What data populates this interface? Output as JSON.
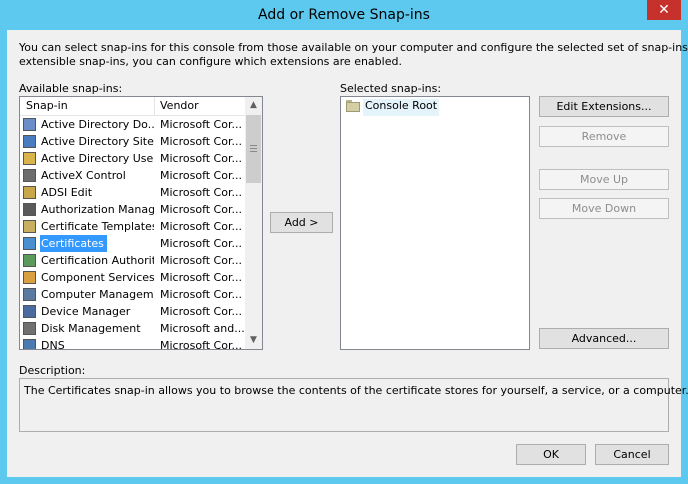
{
  "window": {
    "title": "Add or Remove Snap-ins",
    "close_glyph": "✕"
  },
  "intro_text_1": "You can select snap-ins for this console from those available on your computer and configure the selected set of snap-ins. For",
  "intro_text_2": "extensible snap-ins, you can configure which extensions are enabled.",
  "available": {
    "label": "Available snap-ins:",
    "col_snapin": "Snap-in",
    "col_vendor": "Vendor",
    "items": [
      {
        "name": "Active Directory Do...",
        "vendor": "Microsoft Cor...",
        "icon": "ad-domains-icon",
        "color": "#6a8fc8"
      },
      {
        "name": "Active Directory Site...",
        "vendor": "Microsoft Cor...",
        "icon": "ad-sites-icon",
        "color": "#4a7bc0"
      },
      {
        "name": "Active Directory Use...",
        "vendor": "Microsoft Cor...",
        "icon": "ad-users-icon",
        "color": "#d9b44a"
      },
      {
        "name": "ActiveX Control",
        "vendor": "Microsoft Cor...",
        "icon": "activex-icon",
        "color": "#6c6c6c"
      },
      {
        "name": "ADSI Edit",
        "vendor": "Microsoft Cor...",
        "icon": "adsi-edit-icon",
        "color": "#c9a64a"
      },
      {
        "name": "Authorization Manager",
        "vendor": "Microsoft Cor...",
        "icon": "authorization-icon",
        "color": "#5a5a5a"
      },
      {
        "name": "Certificate Templates",
        "vendor": "Microsoft Cor...",
        "icon": "certificate-templates-icon",
        "color": "#c8b060"
      },
      {
        "name": "Certificates",
        "vendor": "Microsoft Cor...",
        "icon": "certificates-icon",
        "color": "#4a8fd0"
      },
      {
        "name": "Certification Authority",
        "vendor": "Microsoft Cor...",
        "icon": "certification-authority-icon",
        "color": "#5a9a5a"
      },
      {
        "name": "Component Services",
        "vendor": "Microsoft Cor...",
        "icon": "component-services-icon",
        "color": "#d8a040"
      },
      {
        "name": "Computer Managem...",
        "vendor": "Microsoft Cor...",
        "icon": "computer-management-icon",
        "color": "#5a7aa0"
      },
      {
        "name": "Device Manager",
        "vendor": "Microsoft Cor...",
        "icon": "device-manager-icon",
        "color": "#4a6aa0"
      },
      {
        "name": "Disk Management",
        "vendor": "Microsoft and...",
        "icon": "disk-management-icon",
        "color": "#707070"
      },
      {
        "name": "DNS",
        "vendor": "Microsoft Cor...",
        "icon": "dns-icon",
        "color": "#4a7ab0"
      }
    ],
    "selected_index": 7
  },
  "add_button": "Add >",
  "selected": {
    "label": "Selected snap-ins:",
    "root": "Console Root"
  },
  "buttons": {
    "edit_extensions": "Edit Extensions...",
    "remove": "Remove",
    "move_up": "Move Up",
    "move_down": "Move Down",
    "advanced": "Advanced...",
    "ok": "OK",
    "cancel": "Cancel"
  },
  "description": {
    "label": "Description:",
    "text": "The Certificates snap-in allows you to browse the contents of the certificate stores for yourself, a service, or a computer."
  },
  "colors": {
    "frame": "#5ec9ee",
    "close": "#c7312b",
    "selection": "#3399ff"
  }
}
